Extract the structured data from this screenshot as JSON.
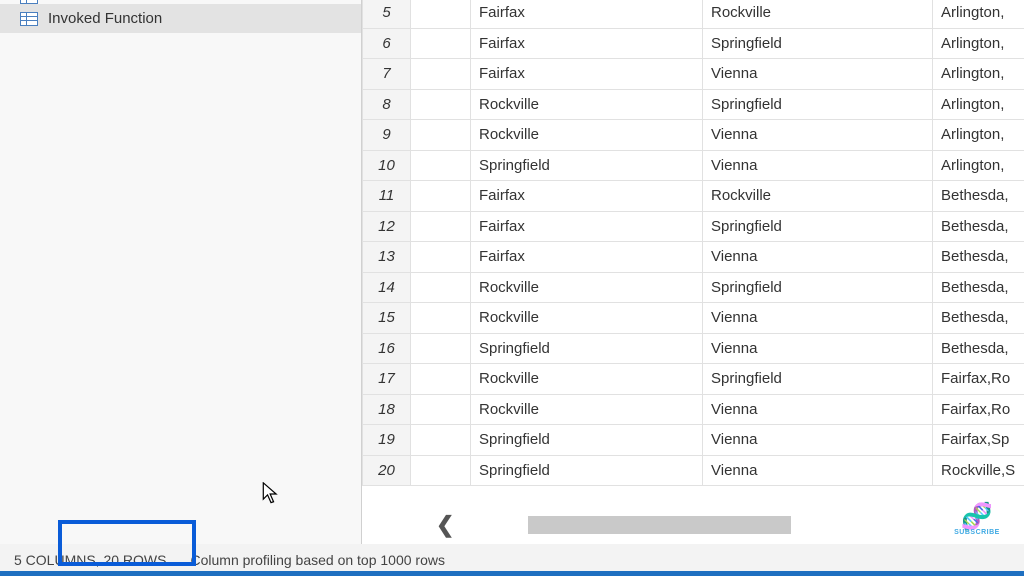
{
  "sidebar": {
    "items": [
      {
        "label": ""
      },
      {
        "label": "Invoked Function"
      }
    ]
  },
  "grid": {
    "rows": [
      {
        "n": "5",
        "a": "Fairfax",
        "b": "Rockville",
        "c": "Arlington,"
      },
      {
        "n": "6",
        "a": "Fairfax",
        "b": "Springfield",
        "c": "Arlington,"
      },
      {
        "n": "7",
        "a": "Fairfax",
        "b": "Vienna",
        "c": "Arlington,"
      },
      {
        "n": "8",
        "a": "Rockville",
        "b": "Springfield",
        "c": "Arlington,"
      },
      {
        "n": "9",
        "a": "Rockville",
        "b": "Vienna",
        "c": "Arlington,"
      },
      {
        "n": "10",
        "a": "Springfield",
        "b": "Vienna",
        "c": "Arlington,"
      },
      {
        "n": "11",
        "a": "Fairfax",
        "b": "Rockville",
        "c": "Bethesda,"
      },
      {
        "n": "12",
        "a": "Fairfax",
        "b": "Springfield",
        "c": "Bethesda,"
      },
      {
        "n": "13",
        "a": "Fairfax",
        "b": "Vienna",
        "c": "Bethesda,"
      },
      {
        "n": "14",
        "a": "Rockville",
        "b": "Springfield",
        "c": "Bethesda,"
      },
      {
        "n": "15",
        "a": "Rockville",
        "b": "Vienna",
        "c": "Bethesda,"
      },
      {
        "n": "16",
        "a": "Springfield",
        "b": "Vienna",
        "c": "Bethesda,"
      },
      {
        "n": "17",
        "a": "Rockville",
        "b": "Springfield",
        "c": "Fairfax,Ro"
      },
      {
        "n": "18",
        "a": "Rockville",
        "b": "Vienna",
        "c": "Fairfax,Ro"
      },
      {
        "n": "19",
        "a": "Springfield",
        "b": "Vienna",
        "c": "Fairfax,Sp"
      },
      {
        "n": "20",
        "a": "Springfield",
        "b": "Vienna",
        "c": "Rockville,S"
      }
    ]
  },
  "status": {
    "rowcount": "5 COLUMNS, 20 ROWS",
    "profiling": "Column profiling based on top 1000 rows"
  },
  "watermark": {
    "subscribe": "SUBSCRIBE"
  }
}
